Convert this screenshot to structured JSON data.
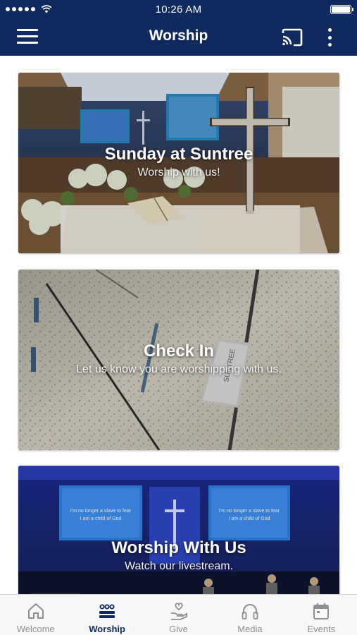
{
  "status_bar": {
    "time": "10:26 AM"
  },
  "header": {
    "title": "Worship"
  },
  "cards": [
    {
      "title": "Sunday at Suntree",
      "subtitle": "Worship with us!"
    },
    {
      "title": "Check In",
      "subtitle": "Let us know you are worshipping with us."
    },
    {
      "title": "Worship With Us",
      "subtitle": "Watch our livestream."
    }
  ],
  "tabs": [
    {
      "label": "Welcome",
      "icon": "home-icon"
    },
    {
      "label": "Worship",
      "icon": "worship-icon",
      "active": true
    },
    {
      "label": "Give",
      "icon": "give-icon"
    },
    {
      "label": "Media",
      "icon": "headphones-icon"
    },
    {
      "label": "Events",
      "icon": "calendar-icon"
    }
  ],
  "colors": {
    "brand": "#0f2a5e",
    "tab_inactive": "#8e8e93",
    "tab_bar_bg": "#f7f7f7"
  }
}
